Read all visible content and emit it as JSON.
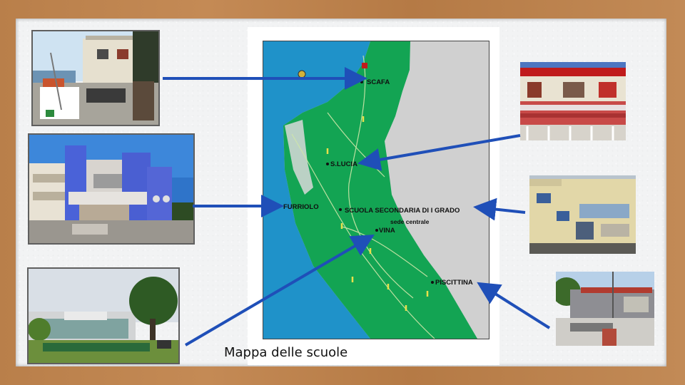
{
  "caption": "Mappa delle scuole",
  "map_labels": {
    "scafa": "SCAFA",
    "s_lucia": "S.LUCIA",
    "furriolo": "FURRIOLO",
    "scuola_secondaria": "SCUOLA SECONDARIA DI I GRADO",
    "sede_centrale": "sede centrale",
    "vina": "VINA",
    "piscittina": "PISCITTINA"
  },
  "colors": {
    "frame": "#c08650",
    "board": "#f2f3f4",
    "sea": "#1f92c9",
    "land": "#13a453",
    "arrow": "#1f4fb8"
  }
}
